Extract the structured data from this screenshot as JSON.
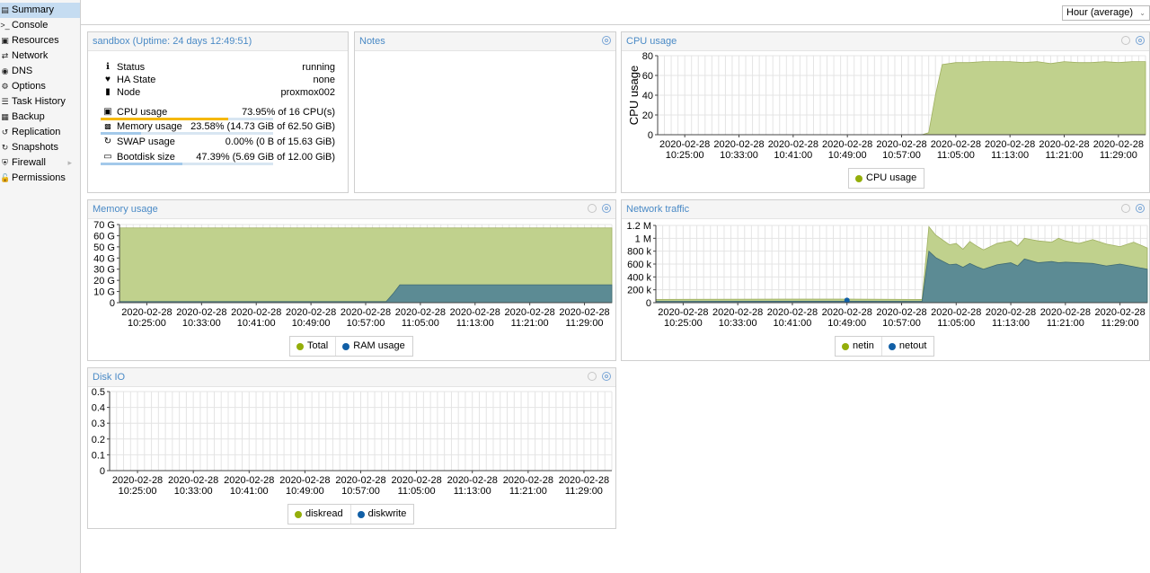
{
  "sidebar": {
    "items": [
      {
        "label": "Summary",
        "icon": "summary-icon",
        "active": true
      },
      {
        "label": "Console",
        "icon": "terminal-icon"
      },
      {
        "label": "Resources",
        "icon": "resources-icon"
      },
      {
        "label": "Network",
        "icon": "network-icon"
      },
      {
        "label": "DNS",
        "icon": "globe-icon"
      },
      {
        "label": "Options",
        "icon": "gear-icon"
      },
      {
        "label": "Task History",
        "icon": "list-icon"
      },
      {
        "label": "Backup",
        "icon": "floppy-icon"
      },
      {
        "label": "Replication",
        "icon": "retweet-icon"
      },
      {
        "label": "Snapshots",
        "icon": "history-icon"
      },
      {
        "label": "Firewall",
        "icon": "shield-icon",
        "has_submenu": true
      },
      {
        "label": "Permissions",
        "icon": "unlock-icon"
      }
    ]
  },
  "toolbar": {
    "timeframe": "Hour (average)"
  },
  "status_panel": {
    "title": "sandbox (Uptime: 24 days 12:49:51)",
    "rows": [
      {
        "label": "Status",
        "value": "running",
        "icon": "info-icon"
      },
      {
        "label": "HA State",
        "value": "none",
        "icon": "heartbeat-icon"
      },
      {
        "label": "Node",
        "value": "proxmox002",
        "icon": "building-icon"
      }
    ],
    "usage": [
      {
        "label": "CPU usage",
        "value": "73.95% of 16 CPU(s)",
        "icon": "cpu-icon",
        "fraction": 0.7395,
        "bar_color": "#f5b800"
      },
      {
        "label": "Memory usage",
        "value": "23.58% (14.73 GiB of 62.50 GiB)",
        "icon": "memory-icon",
        "fraction": 0.2358,
        "bar_color": "#a3c9ea"
      },
      {
        "label": "SWAP usage",
        "value": "0.00% (0 B of 15.63 GiB)",
        "icon": "refresh-icon",
        "fraction": 0.0,
        "bar_color": "#a3c9ea"
      },
      {
        "label": "Bootdisk size",
        "value": "47.39% (5.69 GiB of 12.00 GiB)",
        "icon": "hdd-icon",
        "fraction": 0.4739,
        "bar_color": "#a3c9ea"
      }
    ]
  },
  "notes_panel": {
    "title": "Notes"
  },
  "colors": {
    "green": "#c0d18d",
    "green_line": "#94ae0a",
    "blue": "#5c8b94",
    "blue_line": "#115fa6",
    "dot_green": "#94ae0a",
    "dot_blue": "#115fa6"
  },
  "chart_data": [
    {
      "id": "cpu",
      "title": "CPU usage",
      "type": "area",
      "ylabel": "CPU usage",
      "ylim": [
        0,
        80
      ],
      "yticks": [
        "0",
        "20",
        "40",
        "60",
        "80"
      ],
      "ytick_values": [
        0,
        20,
        40,
        60,
        80
      ],
      "x_date_labels": [
        "2020-02-28",
        "2020-02-28",
        "2020-02-28",
        "2020-02-28",
        "2020-02-28",
        "2020-02-28",
        "2020-02-28",
        "2020-02-28",
        "2020-02-28"
      ],
      "x_time_labels": [
        "10:25:00",
        "10:33:00",
        "10:41:00",
        "10:49:00",
        "10:57:00",
        "11:05:00",
        "11:13:00",
        "11:21:00",
        "11:29:00"
      ],
      "xlim": [
        "10:21",
        "11:33"
      ],
      "x": [
        "10:21",
        "10:43",
        "11:00",
        "11:01",
        "11:02",
        "11:03",
        "11:05",
        "11:07",
        "11:09",
        "11:11",
        "11:13",
        "11:15",
        "11:17",
        "11:19",
        "11:21",
        "11:23",
        "11:25",
        "11:27",
        "11:29",
        "11:31",
        "11:33"
      ],
      "series": [
        {
          "name": "CPU usage",
          "color": "#c0d18d",
          "values": [
            0,
            0,
            0,
            2,
            40,
            71,
            73,
            73,
            74,
            74,
            74,
            73,
            74,
            72,
            74,
            73,
            73,
            74,
            73,
            74,
            74
          ]
        }
      ],
      "legend": [
        "CPU usage"
      ]
    },
    {
      "id": "memory",
      "title": "Memory usage",
      "type": "area",
      "ylim": [
        0,
        70
      ],
      "yticks": [
        "0",
        "10 G",
        "20 G",
        "30 G",
        "40 G",
        "50 G",
        "60 G",
        "70 G"
      ],
      "ytick_values": [
        0,
        10,
        20,
        30,
        40,
        50,
        60,
        70
      ],
      "x_date_labels": [
        "2020-02-28",
        "2020-02-28",
        "2020-02-28",
        "2020-02-28",
        "2020-02-28",
        "2020-02-28",
        "2020-02-28",
        "2020-02-28",
        "2020-02-28"
      ],
      "x_time_labels": [
        "10:25:00",
        "10:33:00",
        "10:41:00",
        "10:49:00",
        "10:57:00",
        "11:05:00",
        "11:13:00",
        "11:21:00",
        "11:29:00"
      ],
      "xlim": [
        "10:21",
        "11:33"
      ],
      "x": [
        "10:21",
        "11:00",
        "11:01",
        "11:02",
        "11:33"
      ],
      "series": [
        {
          "name": "Total",
          "color": "#c0d18d",
          "values": [
            67,
            67,
            67,
            67,
            67
          ]
        },
        {
          "name": "RAM usage",
          "color": "#5c8b94",
          "values": [
            1,
            1,
            8,
            16,
            16
          ]
        }
      ],
      "legend": [
        "Total",
        "RAM usage"
      ]
    },
    {
      "id": "network",
      "title": "Network traffic",
      "type": "area",
      "ylim": [
        0,
        1200000
      ],
      "yticks": [
        "0",
        "200 k",
        "400 k",
        "600 k",
        "800 k",
        "1 M",
        "1.2 M"
      ],
      "ytick_values": [
        0,
        200000,
        400000,
        600000,
        800000,
        1000000,
        1200000
      ],
      "x_date_labels": [
        "2020-02-28",
        "2020-02-28",
        "2020-02-28",
        "2020-02-28",
        "2020-02-28",
        "2020-02-28",
        "2020-02-28",
        "2020-02-28",
        "2020-02-28"
      ],
      "x_time_labels": [
        "10:25:00",
        "10:33:00",
        "10:41:00",
        "10:49:00",
        "10:57:00",
        "11:05:00",
        "11:13:00",
        "11:21:00",
        "11:29:00"
      ],
      "xlim": [
        "10:21",
        "11:33"
      ],
      "x": [
        "10:21",
        "10:40",
        "10:49",
        "11:00",
        "11:01",
        "11:02",
        "11:04",
        "11:05",
        "11:06",
        "11:07",
        "11:08",
        "11:09",
        "11:11",
        "11:13",
        "11:14",
        "11:15",
        "11:17",
        "11:19",
        "11:20",
        "11:21",
        "11:23",
        "11:25",
        "11:27",
        "11:29",
        "11:31",
        "11:33"
      ],
      "series": [
        {
          "name": "netin",
          "color": "#c0d18d",
          "values": [
            50000,
            55000,
            55000,
            50000,
            1180000,
            1050000,
            900000,
            920000,
            830000,
            950000,
            880000,
            820000,
            920000,
            960000,
            880000,
            1000000,
            960000,
            940000,
            1000000,
            960000,
            920000,
            980000,
            910000,
            870000,
            940000,
            850000
          ]
        },
        {
          "name": "netout",
          "color": "#5c8b94",
          "values": [
            20000,
            22000,
            22000,
            20000,
            800000,
            700000,
            590000,
            600000,
            550000,
            610000,
            560000,
            520000,
            590000,
            620000,
            570000,
            680000,
            620000,
            640000,
            620000,
            630000,
            620000,
            610000,
            570000,
            600000,
            560000,
            520000
          ]
        }
      ],
      "legend": [
        "netin",
        "netout"
      ]
    },
    {
      "id": "diskio",
      "title": "Disk IO",
      "type": "area",
      "ylim": [
        0,
        0.5
      ],
      "yticks": [
        "0",
        "0.1",
        "0.2",
        "0.3",
        "0.4",
        "0.5"
      ],
      "ytick_values": [
        0,
        0.1,
        0.2,
        0.3,
        0.4,
        0.5
      ],
      "x_date_labels": [
        "2020-02-28",
        "2020-02-28",
        "2020-02-28",
        "2020-02-28",
        "2020-02-28",
        "2020-02-28",
        "2020-02-28",
        "2020-02-28",
        "2020-02-28"
      ],
      "x_time_labels": [
        "10:25:00",
        "10:33:00",
        "10:41:00",
        "10:49:00",
        "10:57:00",
        "11:05:00",
        "11:13:00",
        "11:21:00",
        "11:29:00"
      ],
      "xlim": [
        "10:21",
        "11:33"
      ],
      "x": [],
      "series": [
        {
          "name": "diskread",
          "color": "#c0d18d",
          "values": []
        },
        {
          "name": "diskwrite",
          "color": "#5c8b94",
          "values": []
        }
      ],
      "legend": [
        "diskread",
        "diskwrite"
      ]
    }
  ]
}
